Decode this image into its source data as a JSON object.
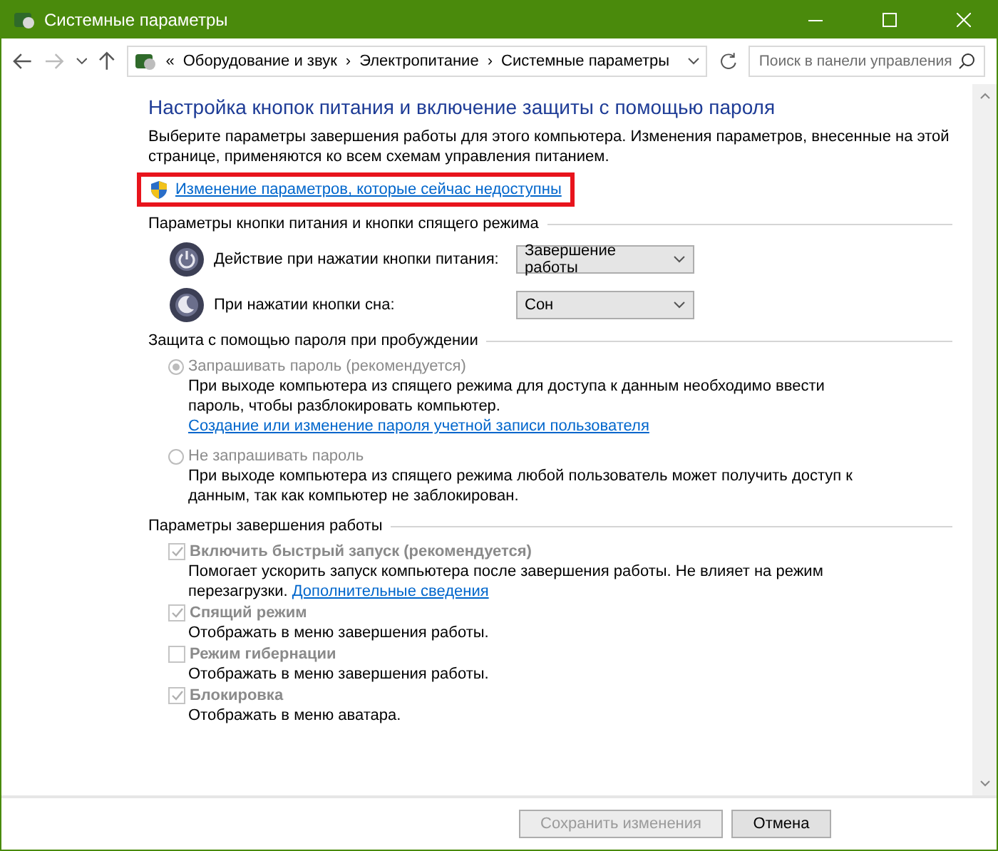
{
  "window": {
    "title": "Системные параметры"
  },
  "address": {
    "prefix": "«",
    "crumbs": [
      "Оборудование и звук",
      "Электропитание",
      "Системные параметры"
    ],
    "separator": "›"
  },
  "search": {
    "placeholder": "Поиск в панели управления"
  },
  "heading": "Настройка кнопок питания и включение защиты с помощью пароля",
  "intro": "Выберите параметры завершения работы для этого компьютера. Изменения параметров, внесенные на этой странице, применяются ко всем схемам управления питанием.",
  "admin_link": {
    "label": "Изменение параметров, которые сейчас недоступны",
    "highlighted": true
  },
  "sections": [
    {
      "kind": "power",
      "title": "Параметры кнопки питания и кнопки спящего режима",
      "rows": [
        {
          "kind": "power",
          "label": "Действие при нажатии кнопки питания:",
          "value": "Завершение работы"
        },
        {
          "kind": "sleep",
          "label": "При нажатии кнопки сна:",
          "value": "Сон"
        }
      ]
    },
    {
      "kind": "radio",
      "title": "Защита с помощью пароля при пробуждении",
      "options": [
        {
          "label": "Запрашивать пароль (рекомендуется)",
          "selected": true,
          "disabled": true,
          "description": "При выходе компьютера из спящего режима для доступа к данным необходимо ввести пароль, чтобы разблокировать компьютер.",
          "link": "Создание или изменение пароля учетной записи пользователя"
        },
        {
          "label": "Не запрашивать пароль",
          "selected": false,
          "disabled": true,
          "description": "При выходе компьютера из спящего режима любой пользователь может получить доступ к данным, так как компьютер не заблокирован."
        }
      ]
    },
    {
      "kind": "checkbox",
      "title": "Параметры завершения работы",
      "options": [
        {
          "label": "Включить быстрый запуск (рекомендуется)",
          "checked": true,
          "disabled": true,
          "description": "Помогает ускорить запуск компьютера после завершения работы. Не влияет на режим перезагрузки.",
          "link": "Дополнительные сведения"
        },
        {
          "label": "Спящий режим",
          "checked": true,
          "disabled": true,
          "description": "Отображать в меню завершения работы."
        },
        {
          "label": "Режим гибернации",
          "checked": false,
          "disabled": true,
          "description": "Отображать в меню завершения работы."
        },
        {
          "label": "Блокировка",
          "checked": true,
          "disabled": true,
          "description": "Отображать в меню аватара."
        }
      ]
    }
  ],
  "buttons": [
    {
      "label": "Сохранить изменения",
      "disabled": true
    },
    {
      "label": "Отмена",
      "disabled": false
    }
  ]
}
